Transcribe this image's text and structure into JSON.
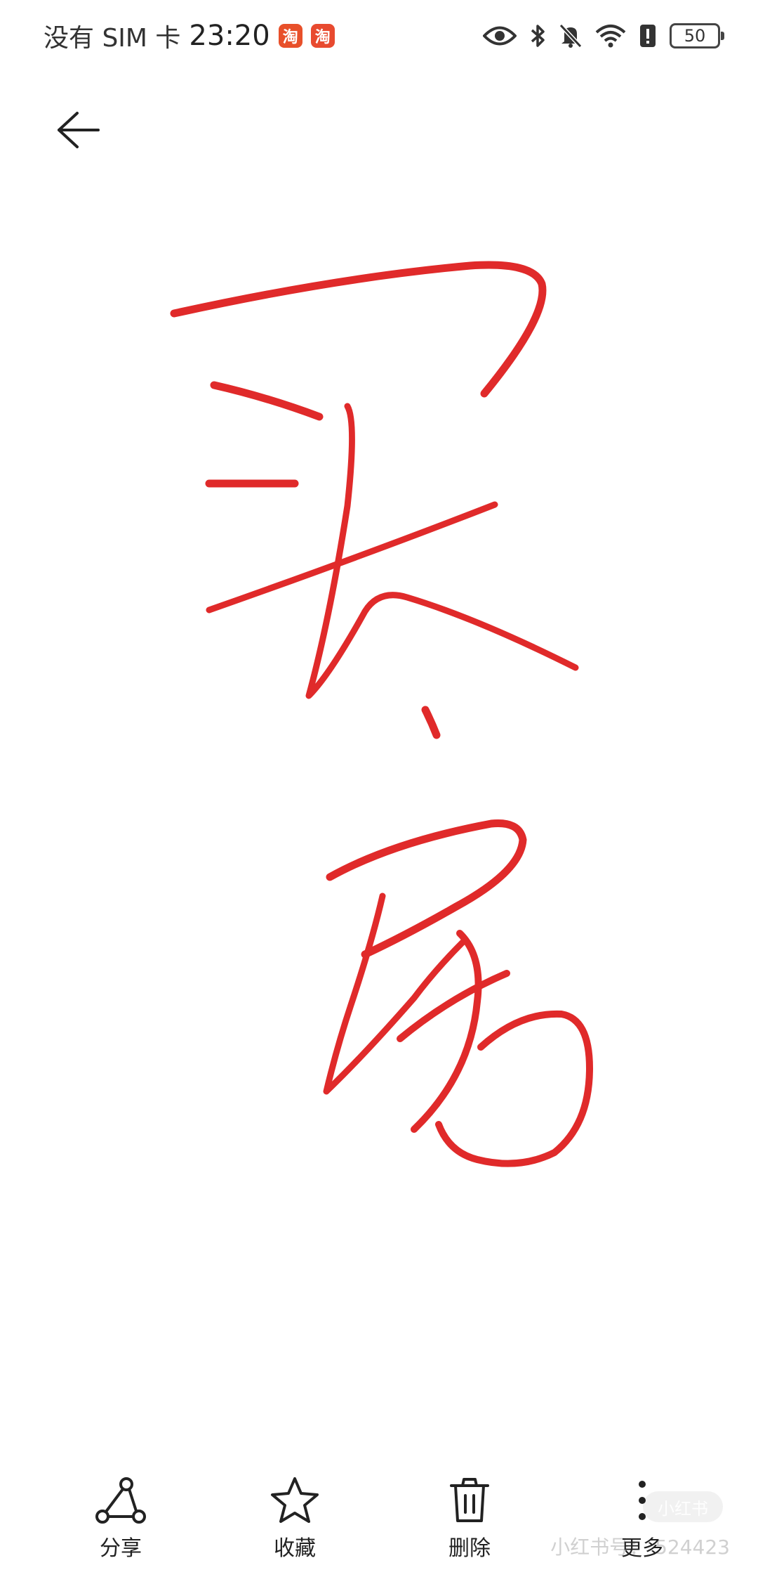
{
  "status_bar": {
    "carrier": "没有 SIM 卡",
    "time": "23:20",
    "app_badges": [
      {
        "label": "淘",
        "color": "#e8502a",
        "name": "taobao-special-icon"
      },
      {
        "label": "淘",
        "color": "#e84a2f",
        "name": "taobao-icon"
      }
    ],
    "icons": [
      "eye-icon",
      "bluetooth-icon",
      "mute-bell-icon",
      "wifi-icon",
      "alert-icon"
    ],
    "battery": "50"
  },
  "header": {
    "back_icon": "arrow-left-icon"
  },
  "drawing": {
    "ink_color": "#e02a2a",
    "background": "#ffffff"
  },
  "toolbar": {
    "share_label": "分享",
    "favorite_label": "收藏",
    "delete_label": "删除",
    "more_label": "更多"
  },
  "watermark": {
    "badge": "小红书",
    "text": "小红书号：  524423"
  }
}
